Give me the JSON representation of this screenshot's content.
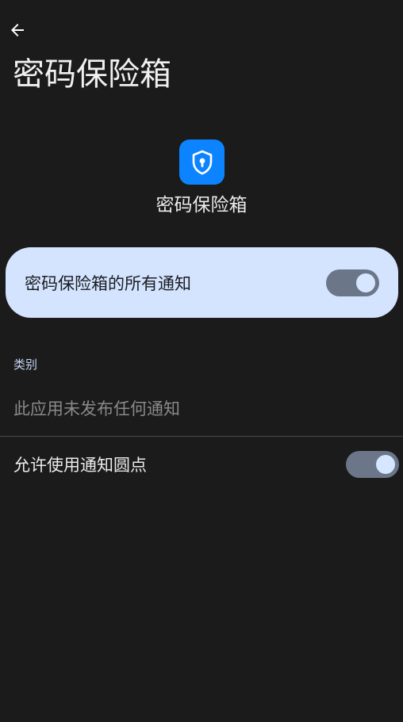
{
  "header": {
    "back_icon": "arrow-back-icon",
    "title": "密码保险箱"
  },
  "app": {
    "icon": "shield-keyhole-icon",
    "icon_color": "#0d84ff",
    "name": "密码保险箱"
  },
  "master_toggle": {
    "label": "密码保险箱的所有通知",
    "enabled": true
  },
  "categories": {
    "header": "类别",
    "empty_message": "此应用未发布任何通知"
  },
  "notification_dot": {
    "label": "允许使用通知圆点",
    "enabled": true
  },
  "colors": {
    "background": "#1b1b1b",
    "card": "#d4e4ff",
    "switch_track": "#6b7689",
    "switch_thumb": "#d7e6ff",
    "section_header": "#c4d6f5"
  }
}
